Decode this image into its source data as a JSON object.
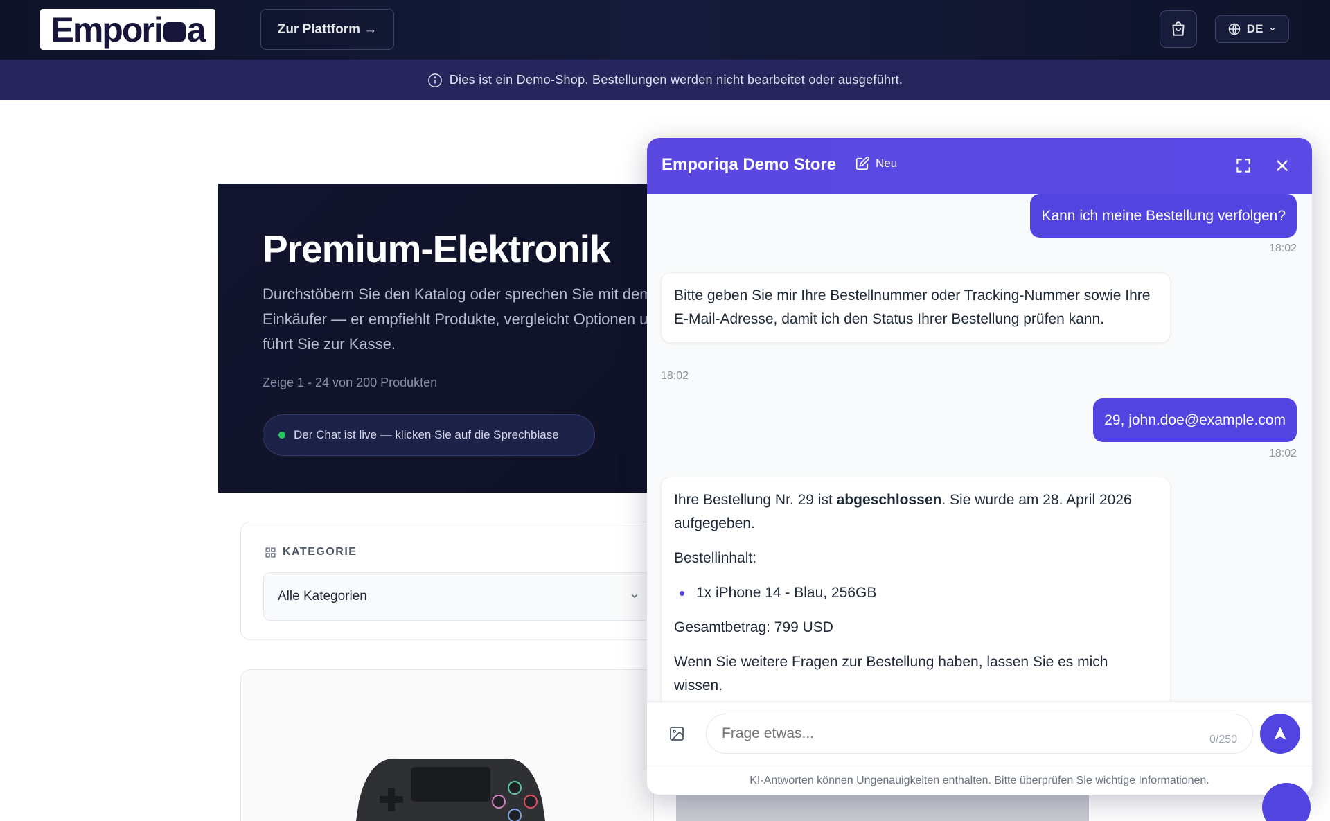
{
  "nav": {
    "logo_text": "Emporiqa",
    "platform_button": "Zur Plattform →",
    "language": "DE"
  },
  "banner": {
    "text": "Dies ist ein Demo-Shop. Bestellungen werden nicht bearbeitet oder ausgeführt."
  },
  "hero": {
    "title": "Premium-Elektronik",
    "description": "Durchstöbern Sie den Katalog oder sprechen Sie mit dem KI-Einkäufer — er empfiehlt Produkte, vergleicht Optionen und führt Sie zur Kasse.",
    "count": "Zeige 1 - 24 von 200 Produkten",
    "live_pill": "Der Chat ist live — klicken Sie auf die Sprechblase"
  },
  "filter": {
    "label": "KATEGORIE",
    "selected": "Alle Kategorien"
  },
  "chat": {
    "title": "Emporiqa Demo Store",
    "new_label": "Neu",
    "messages": [
      {
        "role": "user",
        "text": "Kann ich meine Bestellung verfolgen?",
        "time": "18:02"
      },
      {
        "role": "bot",
        "text": "Bitte geben Sie mir Ihre Bestellnummer oder Tracking-Nummer sowie Ihre E-Mail-Adresse, damit ich den Status Ihrer Bestellung prüfen kann.",
        "time": "18:02"
      },
      {
        "role": "user",
        "text": "29, john.doe@example.com",
        "time": "18:02"
      },
      {
        "role": "bot",
        "intro_pre": "Ihre Bestellung Nr. 29 ist ",
        "intro_bold": "abgeschlossen",
        "intro_post": ". Sie wurde am 28. April 2026 aufgegeben.",
        "items_label": "Bestellinhalt:",
        "items": [
          "1x iPhone 14 - Blau, 256GB"
        ],
        "total": "Gesamtbetrag: 799 USD",
        "closing": "Wenn Sie weitere Fragen zur Bestellung haben, lassen Sie es mich wissen."
      }
    ],
    "input_placeholder": "Frage etwas...",
    "char_count": "0/250",
    "disclaimer": "KI-Antworten können Ungenauigkeiten enthalten. Bitte überprüfen Sie wichtige Informationen."
  },
  "colors": {
    "accent": "#5144e0",
    "nav_bg": "#0f1329",
    "banner_bg": "#26265d",
    "live_dot": "#22c55e"
  }
}
